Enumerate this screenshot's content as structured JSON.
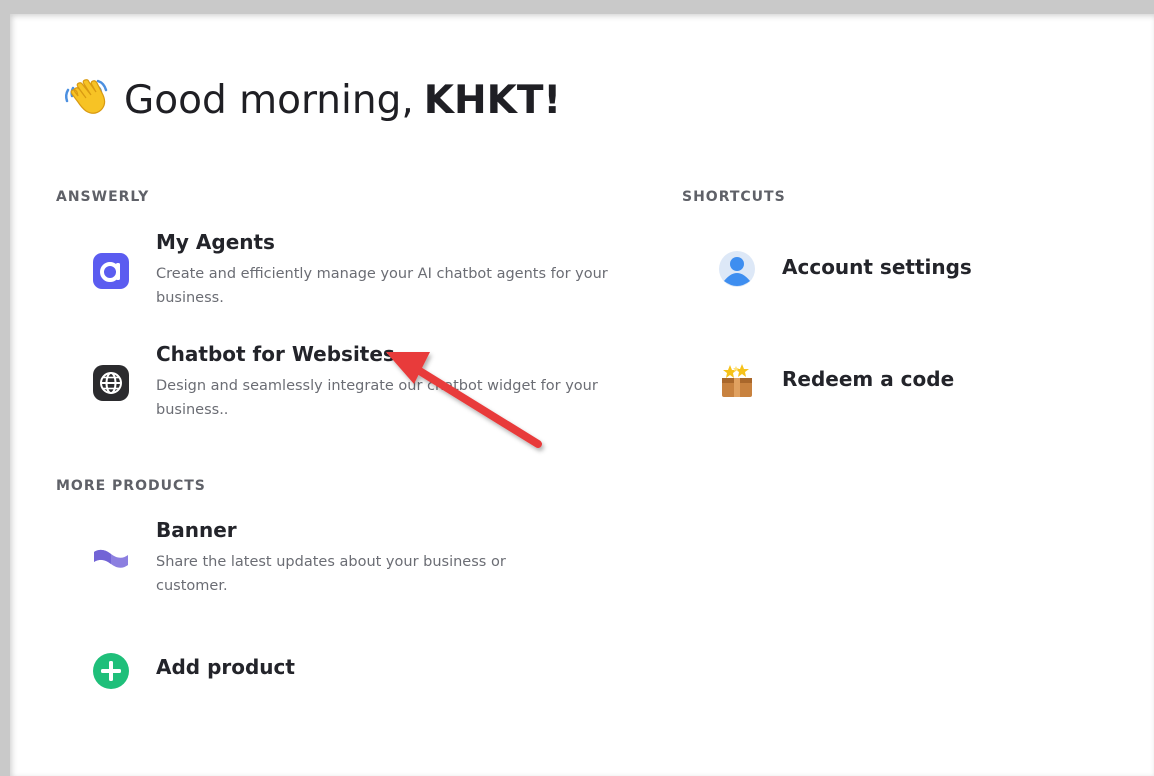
{
  "greeting": {
    "prefix": "Good morning,",
    "name": "KHKT!"
  },
  "sections": {
    "answerly": "ANSWERLY",
    "shortcuts": "SHORTCUTS",
    "more_products": "MORE PRODUCTS"
  },
  "answerly_items": [
    {
      "title": "My Agents",
      "desc": "Create and efficiently manage your AI chatbot agents for your business."
    },
    {
      "title": "Chatbot for Websites",
      "desc": "Design and seamlessly integrate our chatbot widget for your business.."
    }
  ],
  "shortcuts": [
    {
      "title": "Account settings"
    },
    {
      "title": "Redeem a code"
    }
  ],
  "more_products_items": [
    {
      "title": "Banner",
      "desc": "Share the latest updates about your business or customer."
    },
    {
      "title": "Add product"
    }
  ],
  "colors": {
    "agents_icon": "#5b5cf0",
    "chatbot_icon": "#2b2b2e",
    "add_icon": "#1fbf7a",
    "arrow": "#e83b3b",
    "avatar": "#3e8ef0"
  }
}
